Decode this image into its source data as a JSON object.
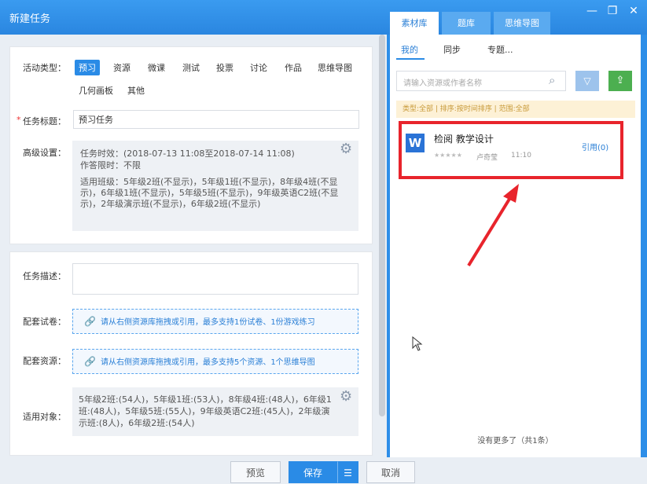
{
  "window": {
    "title": "新建任务",
    "controls": [
      "—",
      "❐",
      "✕"
    ]
  },
  "form": {
    "activity_type_label": "活动类型：",
    "activity_types": [
      "预习",
      "资源",
      "微课",
      "测试",
      "投票",
      "讨论",
      "作品",
      "思维导图",
      "几何画板",
      "其他"
    ],
    "selected_type": "预习",
    "task_title_required": "*",
    "task_title_label": "任务标题：",
    "task_title_value": "预习任务",
    "advanced_label": "高级设置：",
    "advanced": {
      "time_line": "任务时效：(2018-07-13 11:08至2018-07-14 11:08)",
      "limit_line": "作答限时：不限",
      "classes_line": "适用班级：5年级2班(不显示)，5年级1班(不显示)，8年级4班(不显示)，6年级1班(不显示)，5年级5班(不显示)，9年级英语C2班(不显示)，2年级演示班(不显示)，6年级2班(不显示)"
    },
    "description_label": "任务描述：",
    "paper_label": "配套试卷：",
    "paper_hint": "请从右侧资源库拖拽或引用，最多支持1份试卷、1份游戏练习",
    "resource_label": "配套资源：",
    "resource_hint": "请从右侧资源库拖拽或引用，最多支持5个资源、1个思维导图",
    "target_label": "适用对象：",
    "target_value": "5年级2班:(54人)，5年级1班:(53人)，8年级4班:(48人)，6年级1班:(48人)，5年级5班:(55人)，9年级英语C2班:(45人)，2年级演示班:(8人)，6年级2班:(54人)"
  },
  "library": {
    "tabs": [
      "素材库",
      "题库",
      "思维导图"
    ],
    "active_tab": "素材库",
    "subtabs": [
      "我的",
      "同步",
      "专题..."
    ],
    "active_subtab": "我的",
    "search_placeholder": "请输入资源或作者名称",
    "filter_hint": "类型:全部 | 排序:按时间排序 | 范围:全部",
    "item": {
      "title": "检阅 教学设计",
      "stars": "★★★★★",
      "author": "卢奇莹",
      "time": "11:10",
      "cite": "引用(0)"
    },
    "no_more": "没有更多了（共1条）"
  },
  "footer": {
    "preview": "预览",
    "save": "保存",
    "save_menu": "☰",
    "cancel": "取消"
  },
  "colors": {
    "brand_blue": "#2a8be6",
    "highlight_red": "#e8242c"
  }
}
